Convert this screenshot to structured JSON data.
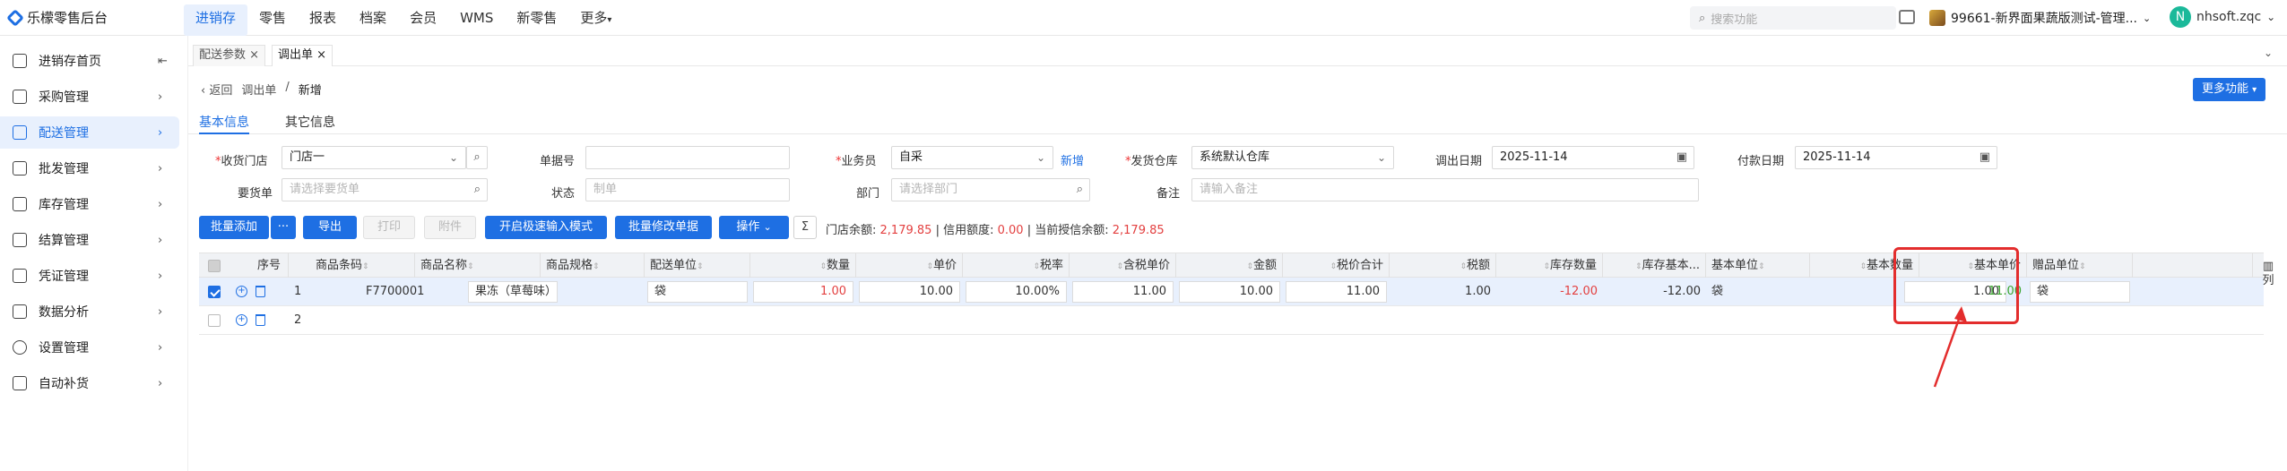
{
  "app": {
    "logo_text": "乐檬零售后台"
  },
  "nav": {
    "items": [
      "进销存",
      "零售",
      "报表",
      "档案",
      "会员",
      "WMS",
      "新零售",
      "更多"
    ],
    "active": "进销存"
  },
  "header": {
    "search_placeholder": "搜索功能",
    "store_name": "99661-新界面果蔬版测试-管理...",
    "user_initial": "N",
    "user_name": "nhsoft.zqc"
  },
  "sidebar": {
    "items": [
      {
        "label": "进销存首页",
        "icon": "home-icon"
      },
      {
        "label": "采购管理",
        "icon": "cart-icon"
      },
      {
        "label": "配送管理",
        "icon": "truck-icon"
      },
      {
        "label": "批发管理",
        "icon": "wholesale-icon"
      },
      {
        "label": "库存管理",
        "icon": "inventory-icon"
      },
      {
        "label": "结算管理",
        "icon": "settlement-icon"
      },
      {
        "label": "凭证管理",
        "icon": "voucher-icon"
      },
      {
        "label": "数据分析",
        "icon": "chart-icon"
      },
      {
        "label": "设置管理",
        "icon": "settings-icon"
      },
      {
        "label": "自动补货",
        "icon": "replenish-icon"
      }
    ],
    "active": "配送管理"
  },
  "tabs": [
    {
      "label": "配送参数 ×"
    },
    {
      "label": "调出单 ×"
    }
  ],
  "breadcrumb": {
    "back": "返回",
    "parent": "调出单",
    "sep": "/",
    "current": "新增"
  },
  "more_functions": "更多功能",
  "subtabs": [
    "基本信息",
    "其它信息"
  ],
  "form": {
    "receive_store": {
      "label": "收货门店",
      "value": "门店一"
    },
    "doc_no": {
      "label": "单据号",
      "value": ""
    },
    "salesman": {
      "label": "业务员",
      "value": "自采",
      "link": "新增"
    },
    "ship_warehouse": {
      "label": "发货仓库",
      "value": "系统默认仓库"
    },
    "out_date": {
      "label": "调出日期",
      "value": "2025-11-14"
    },
    "pay_date": {
      "label": "付款日期",
      "value": "2025-11-14"
    },
    "request_doc": {
      "label": "要货单",
      "placeholder": "请选择要货单"
    },
    "status": {
      "label": "状态",
      "value": "制单"
    },
    "department": {
      "label": "部门",
      "placeholder": "请选择部门"
    },
    "remark": {
      "label": "备注",
      "placeholder": "请输入备注"
    }
  },
  "toolbar": {
    "batch_add": "批量添加",
    "more": "···",
    "export": "导出",
    "print": "打印",
    "attach": "附件",
    "fast_input": "开启极速输入模式",
    "batch_modify": "批量修改单据",
    "operate": "操作",
    "sort_icon": "Σ"
  },
  "balances": {
    "store_balance_label": "门店余额:",
    "store_balance": "2,179.85",
    "credit_label": "信用额度:",
    "credit": "0.00",
    "credit_balance_label": "当前授信余额:",
    "credit_balance": "2,179.85"
  },
  "table": {
    "columns": [
      "序号",
      "商品条码",
      "商品名称",
      "商品规格",
      "配送单位",
      "数量",
      "单价",
      "税率",
      "含税单价",
      "金额",
      "税价合计",
      "税额",
      "库存数量",
      "库存基本...",
      "基本单位",
      "基本数量",
      "基本单价",
      "赠品单位"
    ],
    "rows": [
      {
        "seq": "1",
        "barcode": "F7700001",
        "name": "果冻（草莓味）",
        "spec": "",
        "unit": "袋",
        "qty": "1.00",
        "price": "10.00",
        "tax_rate": "10.00%",
        "tax_price": "11.00",
        "amount": "10.00",
        "total": "11.00",
        "tax": "1.00",
        "stock_qty": "-12.00",
        "stock_base": "-12.00",
        "base_unit": "袋",
        "base_qty": "1.00",
        "base_price": "11.00",
        "gift_unit": "袋"
      },
      {
        "seq": "2"
      }
    ]
  },
  "side_column": "列"
}
